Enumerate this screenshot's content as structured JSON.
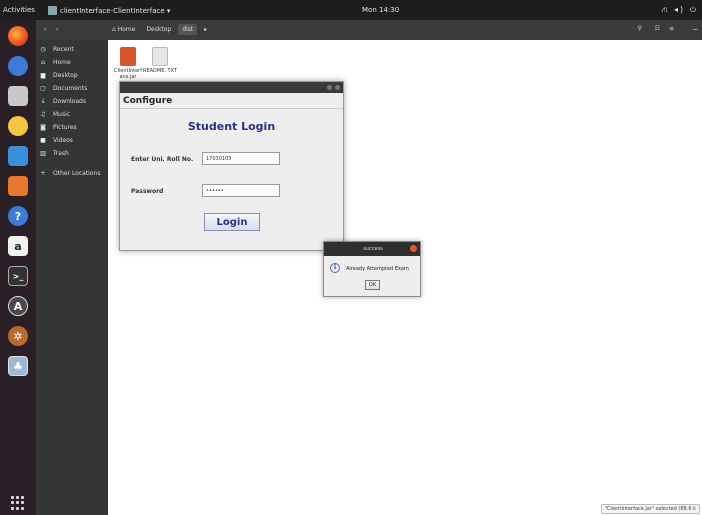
{
  "topbar": {
    "activities": "Activities",
    "app_name": "clientInterface-ClientInterface ▾",
    "clock": "Mon 14:30",
    "tray": "⛙ ◂) ⏻"
  },
  "dock": {
    "amazon_label": "a"
  },
  "file_manager": {
    "nav_back": "‹",
    "nav_forward": "›",
    "crumbs": [
      "⌂ Home",
      "Desktop",
      "dist",
      "▸"
    ],
    "search_icon": "⚲",
    "view_icon": "☷",
    "menu_icon": "≡",
    "min_icon": "⚊",
    "sidebar": [
      {
        "icon": "◷",
        "label": "Recent"
      },
      {
        "icon": "⌂",
        "label": "Home"
      },
      {
        "icon": "▆",
        "label": "Desktop"
      },
      {
        "icon": "▢",
        "label": "Documents"
      },
      {
        "icon": "↓",
        "label": "Downloads"
      },
      {
        "icon": "♫",
        "label": "Music"
      },
      {
        "icon": "◙",
        "label": "Pictures"
      },
      {
        "icon": "■",
        "label": "Videos"
      },
      {
        "icon": "▥",
        "label": "Trash"
      },
      {
        "icon": "+",
        "label": "Other Locations"
      }
    ],
    "files": [
      {
        "name": "ClientInterf ace.jar",
        "color": "#d4562a"
      },
      {
        "name": "README. TXT",
        "color": "#e6e6e6"
      }
    ],
    "status": "\"ClientInterface.jar\" selected (88.6 k"
  },
  "config_window": {
    "title": "Configure",
    "heading": "Student Login",
    "roll_label": "Enter Uni. Roll No.",
    "roll_value": "17030103",
    "password_label": "Password",
    "password_value": "••••••",
    "login_button": "Login"
  },
  "dialog": {
    "title": "success",
    "info_icon": "i",
    "message": "Already Attempted Exam",
    "ok_button": "OK"
  },
  "colors": {
    "heading": "#2a2f8f",
    "dock_bg": "#2a1f26",
    "close": "#e35b2a"
  }
}
